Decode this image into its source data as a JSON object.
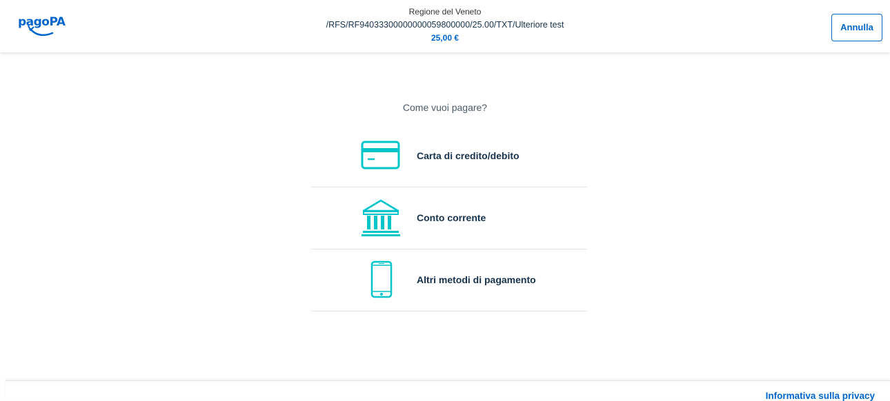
{
  "header": {
    "logo_text": "pagoPA",
    "merchant": "Regione del Veneto",
    "notice_code": "/RFS/RF94033300000000059800000/25.00/TXT/Ulteriore test",
    "amount": "25,00 €",
    "cancel_label": "Annulla"
  },
  "main": {
    "question": "Come vuoi pagare?",
    "methods": [
      {
        "label": "Carta di credito/debito",
        "icon": "credit-card-icon"
      },
      {
        "label": "Conto corrente",
        "icon": "bank-icon"
      },
      {
        "label": "Altri metodi di pagamento",
        "icon": "smartphone-icon"
      }
    ]
  },
  "footer": {
    "privacy_label": "Informativa sulla privacy"
  },
  "colors": {
    "brand_blue": "#0066cc",
    "icon_teal": "#00c5ca",
    "text_dark": "#17324d"
  }
}
